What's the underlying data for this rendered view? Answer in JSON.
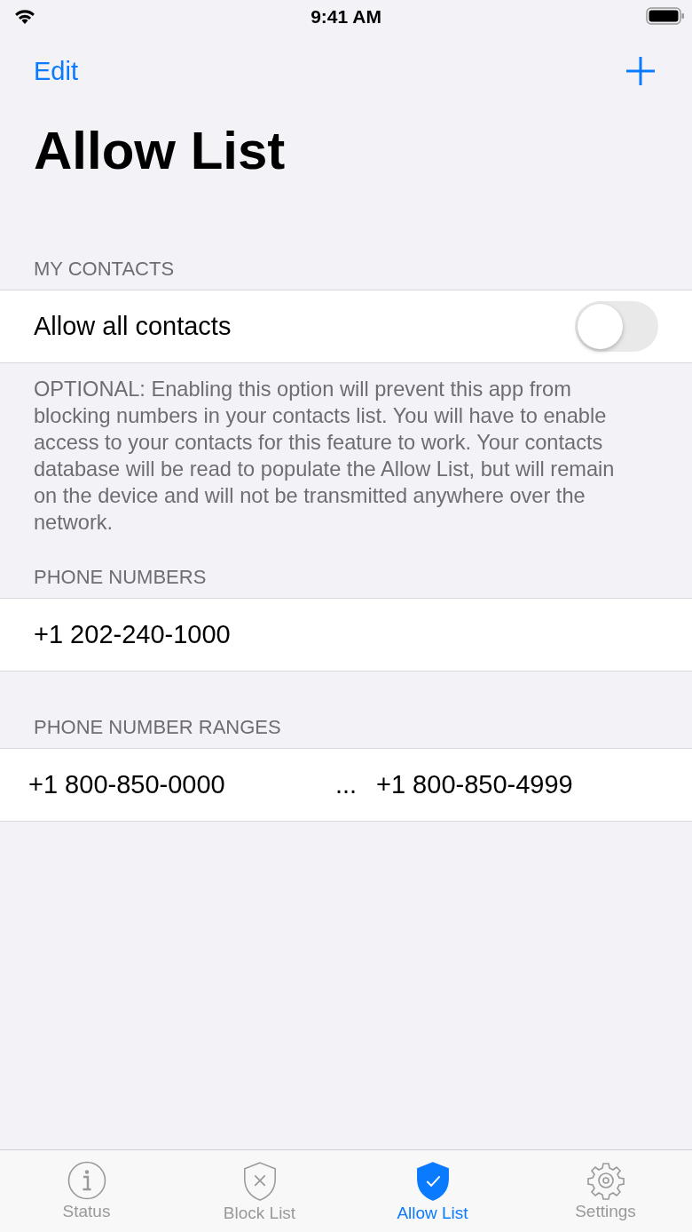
{
  "status_bar": {
    "time": "9:41 AM"
  },
  "nav": {
    "left_button": "Edit"
  },
  "title": "Allow List",
  "sections": [
    {
      "header": "MY CONTACTS",
      "kind": "toggle",
      "rows": [
        {
          "label": "Allow all contacts",
          "on": false
        }
      ],
      "footer": "OPTIONAL: Enabling this option will prevent this app from blocking numbers in your contacts list. You will have to enable access to your contacts for this feature to work. Your contacts database will be read to populate the Allow List, but will remain on the device and will not be transmitted anywhere over the network."
    },
    {
      "header": "PHONE NUMBERS",
      "kind": "number",
      "rows": [
        {
          "label": "+1 202-240-1000"
        }
      ]
    },
    {
      "header": "PHONE NUMBER RANGES",
      "kind": "range",
      "rows": [
        {
          "start": "+1 800-850-0000",
          "separator": "...",
          "end": "+1 800-850-4999"
        }
      ]
    }
  ],
  "tabs": [
    {
      "label": "Status",
      "kind": "info",
      "selected": false
    },
    {
      "label": "Block List",
      "kind": "shield-x",
      "selected": false
    },
    {
      "label": "Allow List",
      "kind": "shield-check",
      "selected": true
    },
    {
      "label": "Settings",
      "kind": "gear",
      "selected": false
    }
  ]
}
